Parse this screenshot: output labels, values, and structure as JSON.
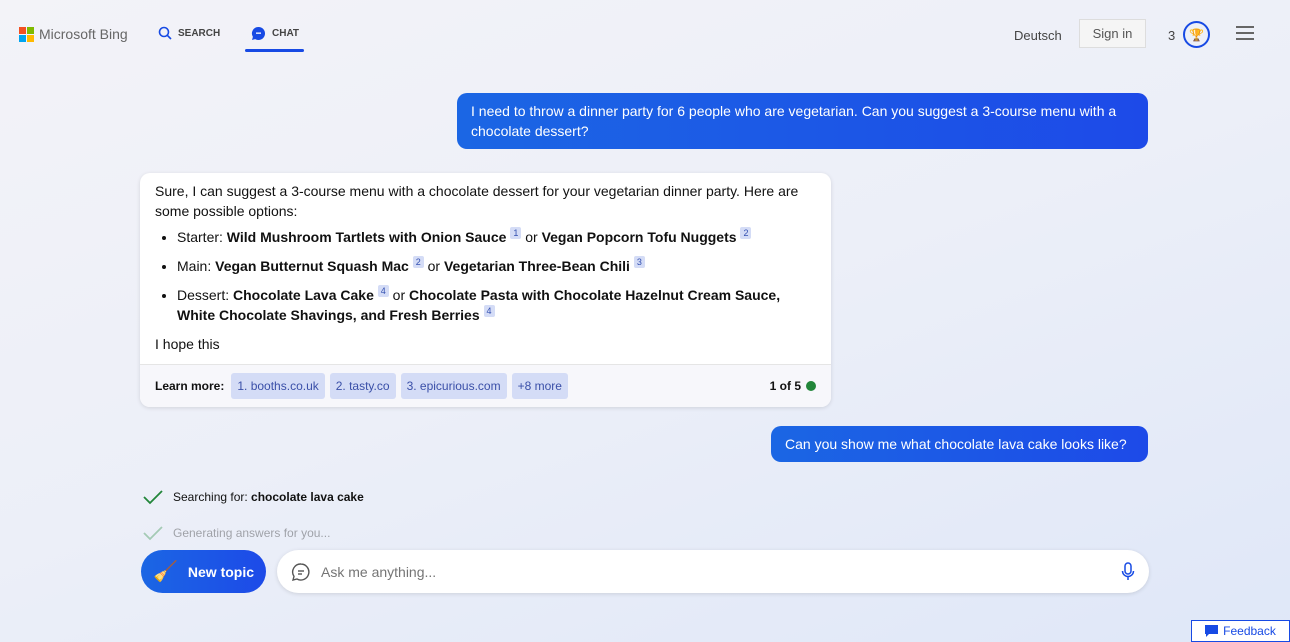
{
  "header": {
    "logo_text": "Microsoft Bing",
    "nav": [
      {
        "label": "SEARCH",
        "icon": "search-icon"
      },
      {
        "label": "CHAT",
        "icon": "chat-icon",
        "active": true
      }
    ],
    "language": "Deutsch",
    "sign_in": "Sign in",
    "points": "3",
    "accent": "#174ae4"
  },
  "messages": {
    "user1": "I need to throw a dinner party for 6 people who are vegetarian. Can you suggest a 3-course menu with a chocolate dessert?",
    "bot": {
      "intro": "Sure, I can suggest a 3-course menu with a chocolate dessert for your vegetarian dinner party. Here are some possible options:",
      "items": [
        {
          "label": "Starter: ",
          "a": "Wild Mushroom Tartlets with Onion Sauce",
          "ca": "1",
          "or": " or ",
          "b": "Vegan Popcorn Tofu Nuggets",
          "cb": "2"
        },
        {
          "label": "Main: ",
          "a": "Vegan Butternut Squash Mac",
          "ca": "2",
          "or": " or ",
          "b": "Vegetarian Three-Bean Chili",
          "cb": "3"
        },
        {
          "label": "Dessert: ",
          "a": "Chocolate Lava Cake",
          "ca": "4",
          "or": " or ",
          "b": "Chocolate Pasta with Chocolate Hazelnut Cream Sauce, White Chocolate Shavings, and Fresh Berries",
          "cb": "4"
        }
      ],
      "outro": "I hope this",
      "learn_more": "Learn more:",
      "links": [
        "1. booths.co.uk",
        "2. tasty.co",
        "3. epicurious.com",
        "+8 more"
      ],
      "page": "1 of 5"
    },
    "user2": "Can you show me what chocolate lava cake looks like?"
  },
  "status": {
    "searching_label": "Searching for: ",
    "searching_query": "chocolate lava cake",
    "generating": "Generating answers for you..."
  },
  "composer": {
    "new_topic": "New topic",
    "placeholder": "Ask me anything..."
  },
  "feedback": "Feedback"
}
